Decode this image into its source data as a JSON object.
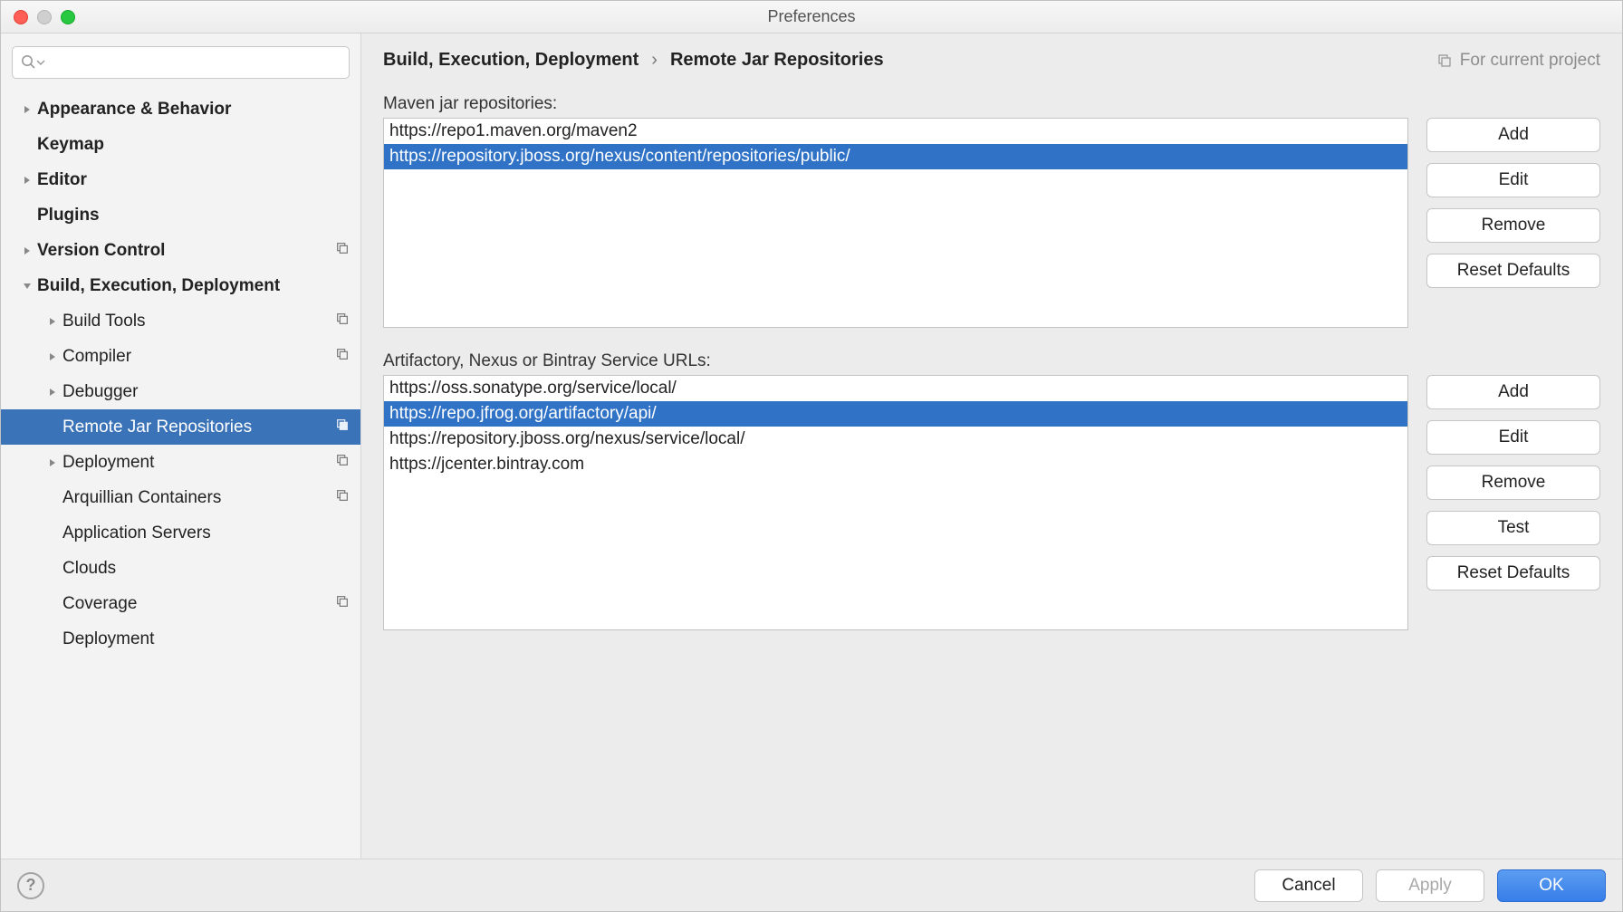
{
  "window": {
    "title": "Preferences"
  },
  "sidebar": {
    "search_placeholder": "",
    "items": [
      {
        "label": "Appearance & Behavior",
        "bold": true,
        "depth": 0,
        "arrow": "right",
        "proj": false
      },
      {
        "label": "Keymap",
        "bold": true,
        "depth": 0,
        "arrow": "none",
        "proj": false
      },
      {
        "label": "Editor",
        "bold": true,
        "depth": 0,
        "arrow": "right",
        "proj": false
      },
      {
        "label": "Plugins",
        "bold": true,
        "depth": 0,
        "arrow": "none",
        "proj": false
      },
      {
        "label": "Version Control",
        "bold": true,
        "depth": 0,
        "arrow": "right",
        "proj": true
      },
      {
        "label": "Build, Execution, Deployment",
        "bold": true,
        "depth": 0,
        "arrow": "down",
        "proj": false
      },
      {
        "label": "Build Tools",
        "bold": false,
        "depth": 1,
        "arrow": "right",
        "proj": true
      },
      {
        "label": "Compiler",
        "bold": false,
        "depth": 1,
        "arrow": "right",
        "proj": true
      },
      {
        "label": "Debugger",
        "bold": false,
        "depth": 1,
        "arrow": "right",
        "proj": false
      },
      {
        "label": "Remote Jar Repositories",
        "bold": false,
        "depth": 1,
        "arrow": "none",
        "proj": true,
        "selected": true
      },
      {
        "label": "Deployment",
        "bold": false,
        "depth": 1,
        "arrow": "right",
        "proj": true
      },
      {
        "label": "Arquillian Containers",
        "bold": false,
        "depth": 1,
        "arrow": "none",
        "proj": true
      },
      {
        "label": "Application Servers",
        "bold": false,
        "depth": 1,
        "arrow": "none",
        "proj": false
      },
      {
        "label": "Clouds",
        "bold": false,
        "depth": 1,
        "arrow": "none",
        "proj": false
      },
      {
        "label": "Coverage",
        "bold": false,
        "depth": 1,
        "arrow": "none",
        "proj": true
      },
      {
        "label": "Deployment",
        "bold": false,
        "depth": 1,
        "arrow": "none",
        "proj": false
      }
    ]
  },
  "main": {
    "breadcrumb": [
      "Build, Execution, Deployment",
      "Remote Jar Repositories"
    ],
    "scope_label": "For current project",
    "section1": {
      "label": "Maven jar repositories:",
      "items": [
        {
          "text": "https://repo1.maven.org/maven2",
          "selected": false
        },
        {
          "text": "https://repository.jboss.org/nexus/content/repositories/public/",
          "selected": true
        }
      ],
      "buttons": [
        "Add",
        "Edit",
        "Remove",
        "Reset Defaults"
      ]
    },
    "section2": {
      "label": "Artifactory, Nexus or Bintray Service URLs:",
      "items": [
        {
          "text": "https://oss.sonatype.org/service/local/",
          "selected": false
        },
        {
          "text": "https://repo.jfrog.org/artifactory/api/",
          "selected": true
        },
        {
          "text": "https://repository.jboss.org/nexus/service/local/",
          "selected": false
        },
        {
          "text": "https://jcenter.bintray.com",
          "selected": false
        }
      ],
      "buttons": [
        "Add",
        "Edit",
        "Remove",
        "Test",
        "Reset Defaults"
      ]
    }
  },
  "footer": {
    "cancel": "Cancel",
    "apply": "Apply",
    "ok": "OK"
  }
}
